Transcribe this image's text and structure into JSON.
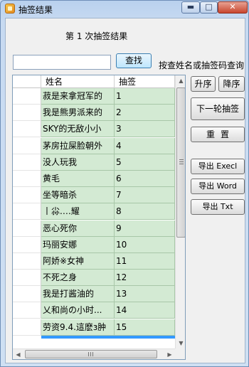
{
  "window": {
    "title": "抽签结果",
    "minimize_glyph": "▬",
    "maximize_glyph": "□",
    "close_glyph": "✕"
  },
  "main": {
    "headline": "第 1 次抽签结果",
    "search": {
      "value": "",
      "placeholder": "",
      "button_label": "查找",
      "hint": "按查姓名或抽签码查询"
    }
  },
  "grid": {
    "columns": [
      "姓名",
      "抽签"
    ],
    "rows": [
      {
        "name": "菽是来拿冠军的",
        "lot": "1"
      },
      {
        "name": "我是熊男派来的",
        "lot": "2"
      },
      {
        "name": "SKY的无敌小小",
        "lot": "3"
      },
      {
        "name": "茅房拉屎脸朝外",
        "lot": "4"
      },
      {
        "name": "没人玩我",
        "lot": "5"
      },
      {
        "name": "黄毛",
        "lot": "6"
      },
      {
        "name": "坐等暗杀",
        "lot": "7"
      },
      {
        "name": "丨尛.…耀",
        "lot": "8"
      },
      {
        "name": "恶心死你",
        "lot": "9"
      },
      {
        "name": "玛丽安娜",
        "lot": "10"
      },
      {
        "name": "阿娇※女神",
        "lot": "11"
      },
      {
        "name": "不死之身",
        "lot": "12"
      },
      {
        "name": "我是打酱油的",
        "lot": "13"
      },
      {
        "name": "乂和尚の小时...",
        "lot": "14"
      },
      {
        "name": "劳资9.4.這麽з肿",
        "lot": "15"
      }
    ],
    "scroll_up_glyph": "▲",
    "scroll_down_glyph": "▼",
    "scroll_left_glyph": "◀",
    "scroll_right_glyph": "▶"
  },
  "side_buttons": {
    "asc": "升序",
    "desc": "降序",
    "next": "下一轮抽签",
    "reset": "重置",
    "export_excel": "导出 Execl",
    "export_word": "导出 Word",
    "export_txt": "导出 Txt"
  }
}
